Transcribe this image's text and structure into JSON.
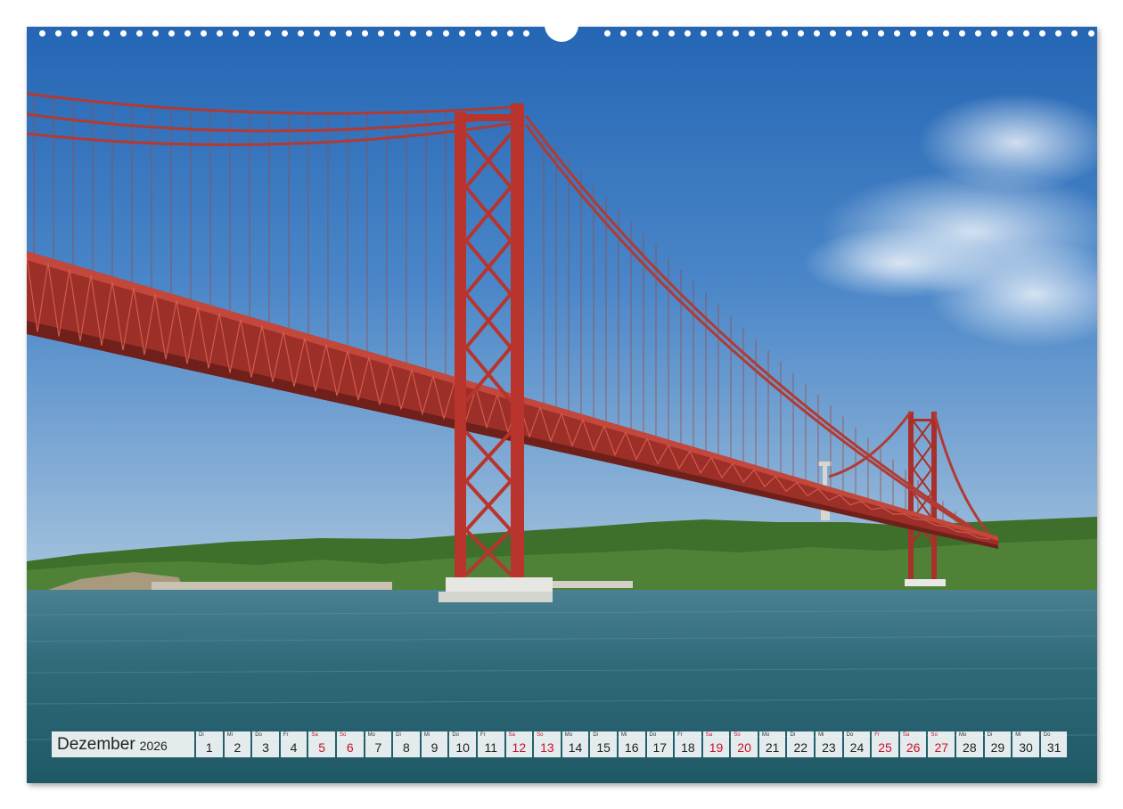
{
  "calendar": {
    "month": "Dezember",
    "year": "2026",
    "weekend_color": "#c8102e",
    "days": [
      {
        "abbr": "Di",
        "num": "1",
        "weekend": false
      },
      {
        "abbr": "Mi",
        "num": "2",
        "weekend": false
      },
      {
        "abbr": "Do",
        "num": "3",
        "weekend": false
      },
      {
        "abbr": "Fr",
        "num": "4",
        "weekend": false
      },
      {
        "abbr": "Sa",
        "num": "5",
        "weekend": true
      },
      {
        "abbr": "So",
        "num": "6",
        "weekend": true
      },
      {
        "abbr": "Mo",
        "num": "7",
        "weekend": false
      },
      {
        "abbr": "Di",
        "num": "8",
        "weekend": false
      },
      {
        "abbr": "Mi",
        "num": "9",
        "weekend": false
      },
      {
        "abbr": "Do",
        "num": "10",
        "weekend": false
      },
      {
        "abbr": "Fr",
        "num": "11",
        "weekend": false
      },
      {
        "abbr": "Sa",
        "num": "12",
        "weekend": true
      },
      {
        "abbr": "So",
        "num": "13",
        "weekend": true
      },
      {
        "abbr": "Mo",
        "num": "14",
        "weekend": false
      },
      {
        "abbr": "Di",
        "num": "15",
        "weekend": false
      },
      {
        "abbr": "Mi",
        "num": "16",
        "weekend": false
      },
      {
        "abbr": "Do",
        "num": "17",
        "weekend": false
      },
      {
        "abbr": "Fr",
        "num": "18",
        "weekend": false
      },
      {
        "abbr": "Sa",
        "num": "19",
        "weekend": true
      },
      {
        "abbr": "So",
        "num": "20",
        "weekend": true
      },
      {
        "abbr": "Mo",
        "num": "21",
        "weekend": false
      },
      {
        "abbr": "Di",
        "num": "22",
        "weekend": false
      },
      {
        "abbr": "Mi",
        "num": "23",
        "weekend": false
      },
      {
        "abbr": "Do",
        "num": "24",
        "weekend": false
      },
      {
        "abbr": "Fr",
        "num": "25",
        "weekend": true
      },
      {
        "abbr": "Sa",
        "num": "26",
        "weekend": true
      },
      {
        "abbr": "So",
        "num": "27",
        "weekend": true
      },
      {
        "abbr": "Mo",
        "num": "28",
        "weekend": false
      },
      {
        "abbr": "Di",
        "num": "29",
        "weekend": false
      },
      {
        "abbr": "Mi",
        "num": "30",
        "weekend": false
      },
      {
        "abbr": "Do",
        "num": "31",
        "weekend": false
      }
    ]
  },
  "photo": {
    "subject": "suspension-bridge",
    "sky_color": "#2f6fb8",
    "water_color": "#2e6b78",
    "bridge_color": "#b8382f",
    "hill_color": "#3f6e2c"
  }
}
